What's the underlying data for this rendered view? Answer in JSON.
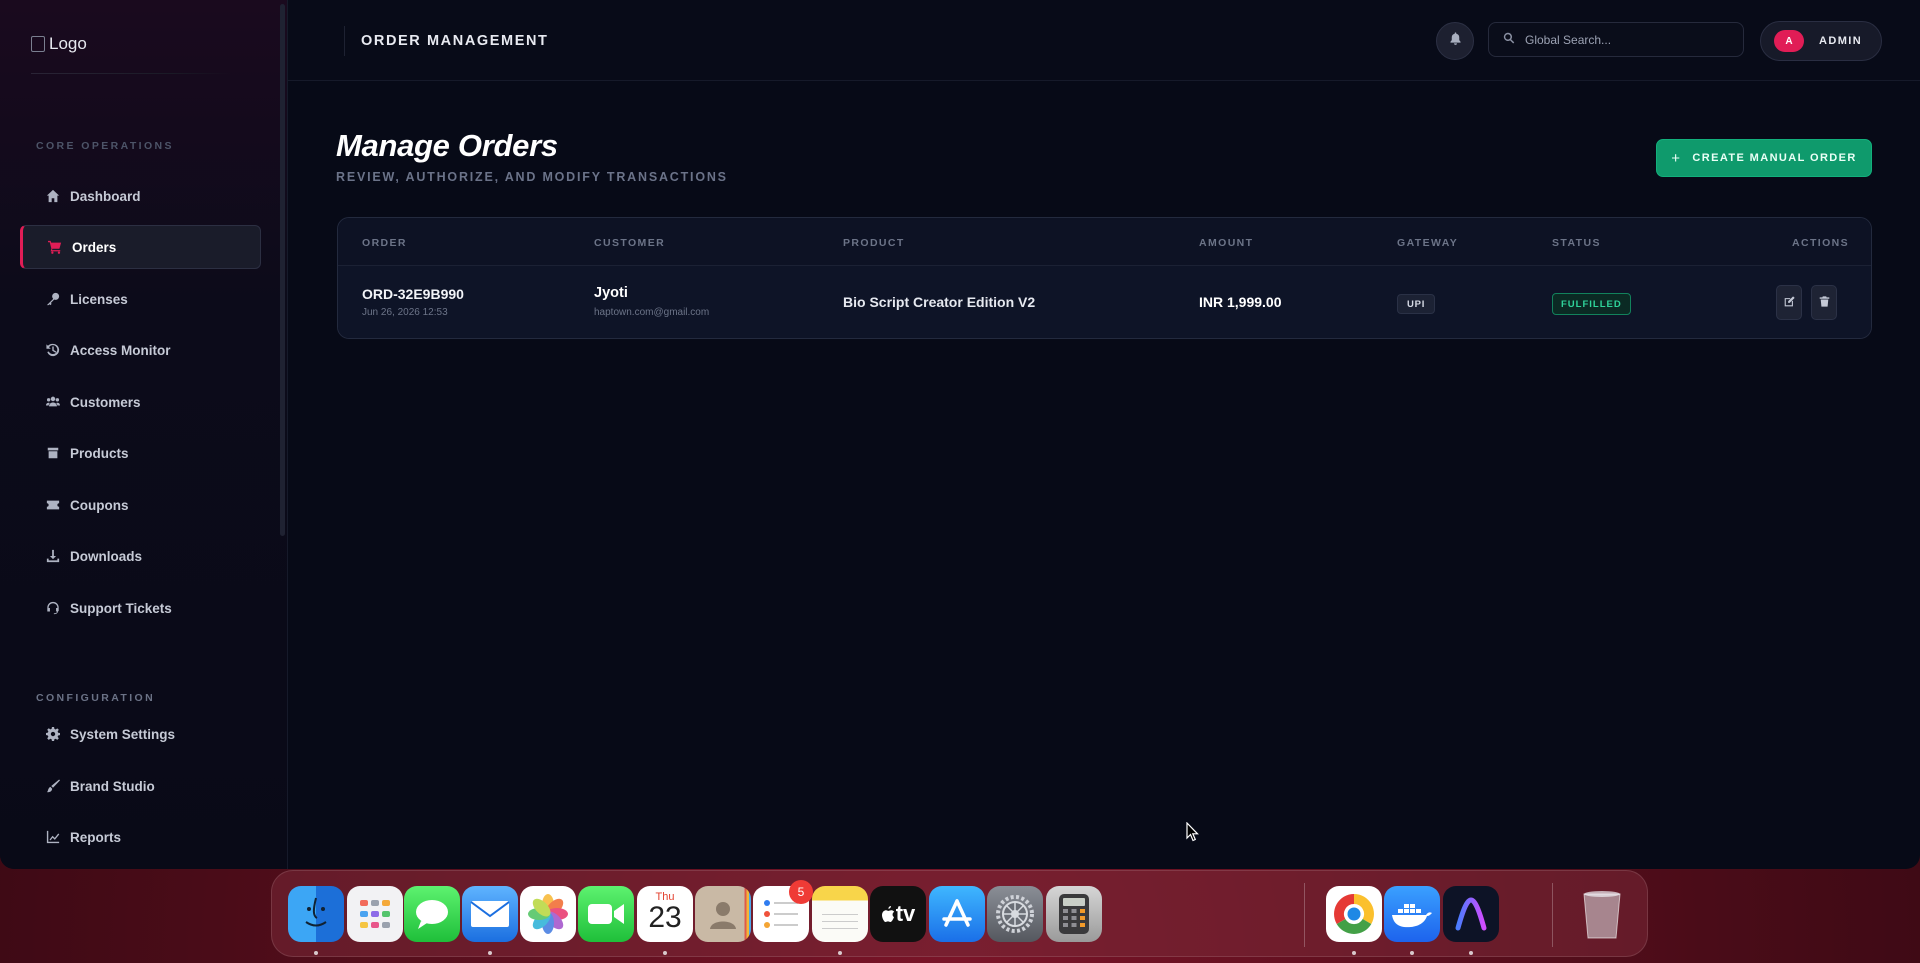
{
  "sidebar": {
    "logo_alt": "Logo",
    "section_core": "CORE OPERATIONS",
    "section_config": "CONFIGURATION",
    "items": [
      {
        "label": "Dashboard",
        "icon": "home-icon"
      },
      {
        "label": "Orders",
        "icon": "cart-icon",
        "active": true
      },
      {
        "label": "Licenses",
        "icon": "key-icon"
      },
      {
        "label": "Access Monitor",
        "icon": "history-icon"
      },
      {
        "label": "Customers",
        "icon": "users-icon"
      },
      {
        "label": "Products",
        "icon": "box-icon"
      },
      {
        "label": "Coupons",
        "icon": "ticket-icon"
      },
      {
        "label": "Downloads",
        "icon": "download-icon"
      },
      {
        "label": "Support Tickets",
        "icon": "headset-icon"
      }
    ],
    "config_items": [
      {
        "label": "System Settings",
        "icon": "gear-icon"
      },
      {
        "label": "Brand Studio",
        "icon": "brush-icon"
      },
      {
        "label": "Reports",
        "icon": "chart-line-icon"
      }
    ]
  },
  "topbar": {
    "section_title": "ORDER MANAGEMENT",
    "search_placeholder": "Global Search...",
    "avatar_initial": "A",
    "user_label": "ADMIN"
  },
  "page": {
    "title": "Manage Orders",
    "subtitle": "REVIEW, AUTHORIZE, AND MODIFY TRANSACTIONS",
    "create_button": "CREATE MANUAL ORDER",
    "create_button_icon": "+"
  },
  "table": {
    "columns": [
      "ORDER",
      "CUSTOMER",
      "PRODUCT",
      "AMOUNT",
      "GATEWAY",
      "STATUS",
      "ACTIONS"
    ],
    "rows": [
      {
        "order_id": "ORD-32E9B990",
        "date": "Jun 26, 2026 12:53",
        "customer_name": "Jyoti",
        "customer_email": "haptown.com@gmail.com",
        "product": "Bio Script Creator Edition V2",
        "amount": "INR 1,999.00",
        "gateway": "UPI",
        "status": "FULFILLED"
      }
    ]
  },
  "dock": {
    "calendar_day": "Thu",
    "calendar_date": "23",
    "reminders_badge": "5",
    "tv_label": "tv"
  },
  "colors": {
    "accent": "#e11d56",
    "primary_button": "#0f9a6c",
    "status_fulfilled": "#2fd39a",
    "background": "#070a17"
  }
}
